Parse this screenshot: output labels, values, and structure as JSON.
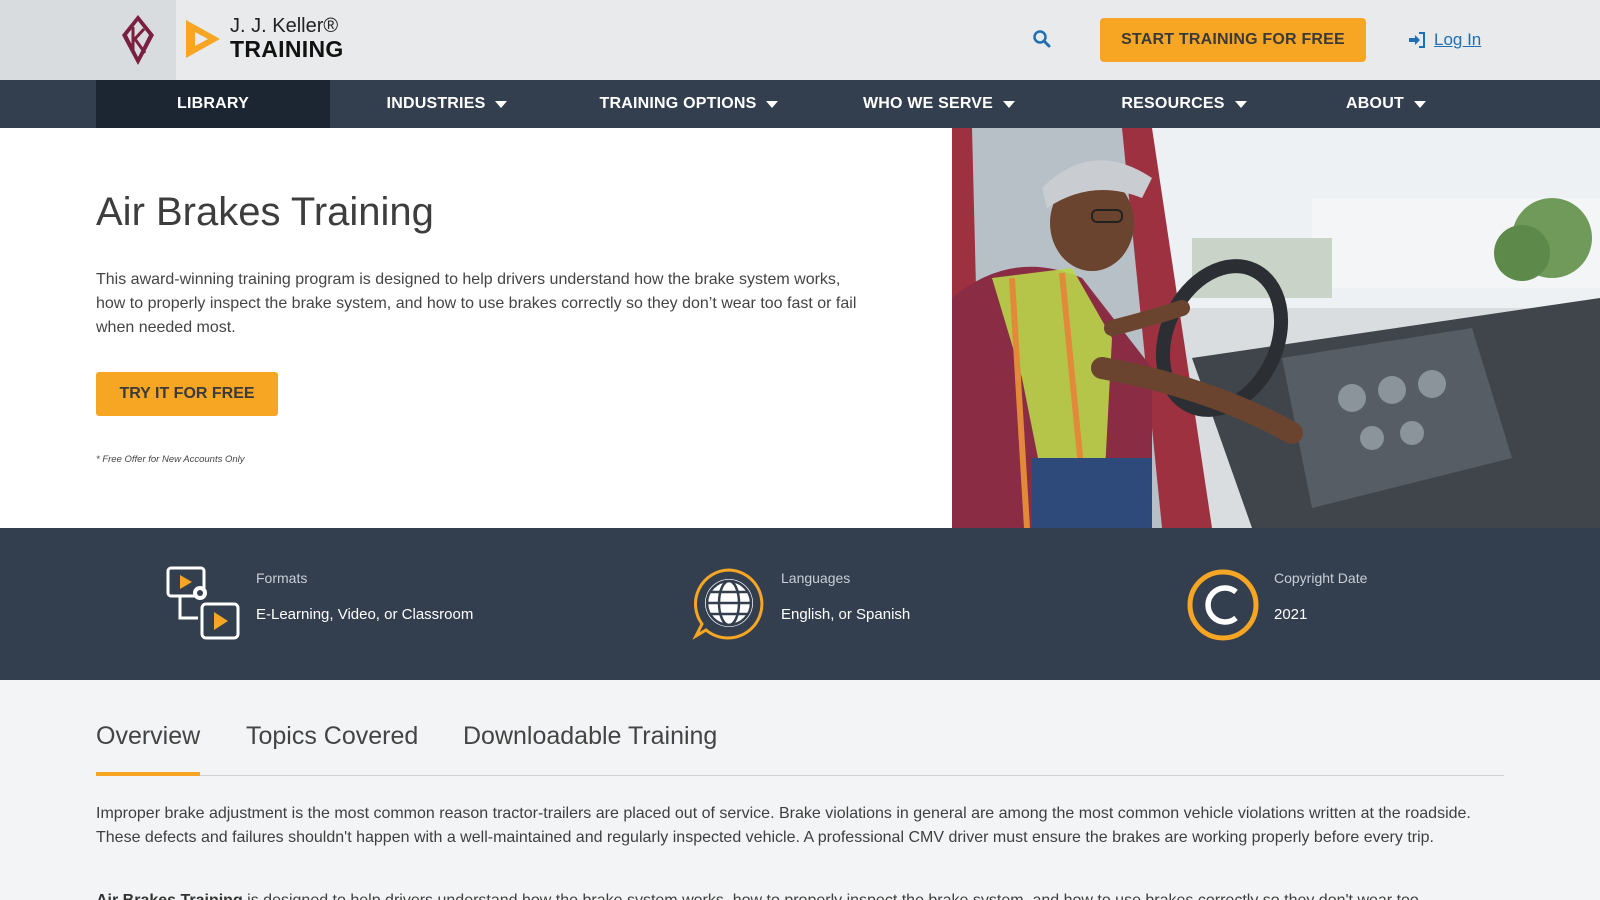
{
  "header": {
    "brand_name": "J. J. Keller®",
    "brand_sub": "TRAINING",
    "cta_label": "START TRAINING FOR FREE",
    "login_label": "Log In",
    "icons": {
      "search": "search-icon",
      "login": "sign-in-icon",
      "logo": "jjkeller-k-logo",
      "play": "play-logo-icon"
    },
    "colors": {
      "accent": "#f6a623",
      "link": "#1f6fb2",
      "nav_bg": "#333f4f"
    }
  },
  "nav": {
    "items": [
      {
        "label": "LIBRARY"
      },
      {
        "label": "INDUSTRIES"
      },
      {
        "label": "TRAINING OPTIONS"
      },
      {
        "label": "WHO WE SERVE"
      },
      {
        "label": "RESOURCES"
      },
      {
        "label": "ABOUT"
      }
    ]
  },
  "hero": {
    "title": "Air Brakes Training",
    "description": "This award-winning training program is designed to help drivers understand how the brake system works, how to properly inspect the brake system, and how to use brakes correctly so they don’t wear too fast or fail when needed most.",
    "cta_label": "TRY IT FOR FREE",
    "fine_print": "* Free Offer for New Accounts Only"
  },
  "info": [
    {
      "label": "Formats",
      "value": "E-Learning, Video, or Classroom",
      "icon": "formats-icon"
    },
    {
      "label": "Languages",
      "value": "English, or Spanish",
      "icon": "globe-icon"
    },
    {
      "label": "Copyright Date",
      "value": "2021",
      "icon": "copyright-icon"
    }
  ],
  "tabs": [
    {
      "label": "Overview"
    },
    {
      "label": "Topics Covered"
    },
    {
      "label": "Downloadable Training"
    }
  ],
  "overview": {
    "paragraph1": "Improper brake adjustment is the most common reason tractor-trailers are placed out of service. Brake violations in general are among the most common vehicle violations written at the roadside. These defects and failures shouldn't happen with a well-maintained and regularly inspected vehicle. A professional CMV driver must ensure the brakes are working properly before every trip.",
    "paragraph2_bold": "Air Brakes Training",
    "paragraph2_rest": " is designed to help drivers understand how the brake system works, how to properly inspect the brake system, and how to use brakes correctly so they don't wear too"
  }
}
